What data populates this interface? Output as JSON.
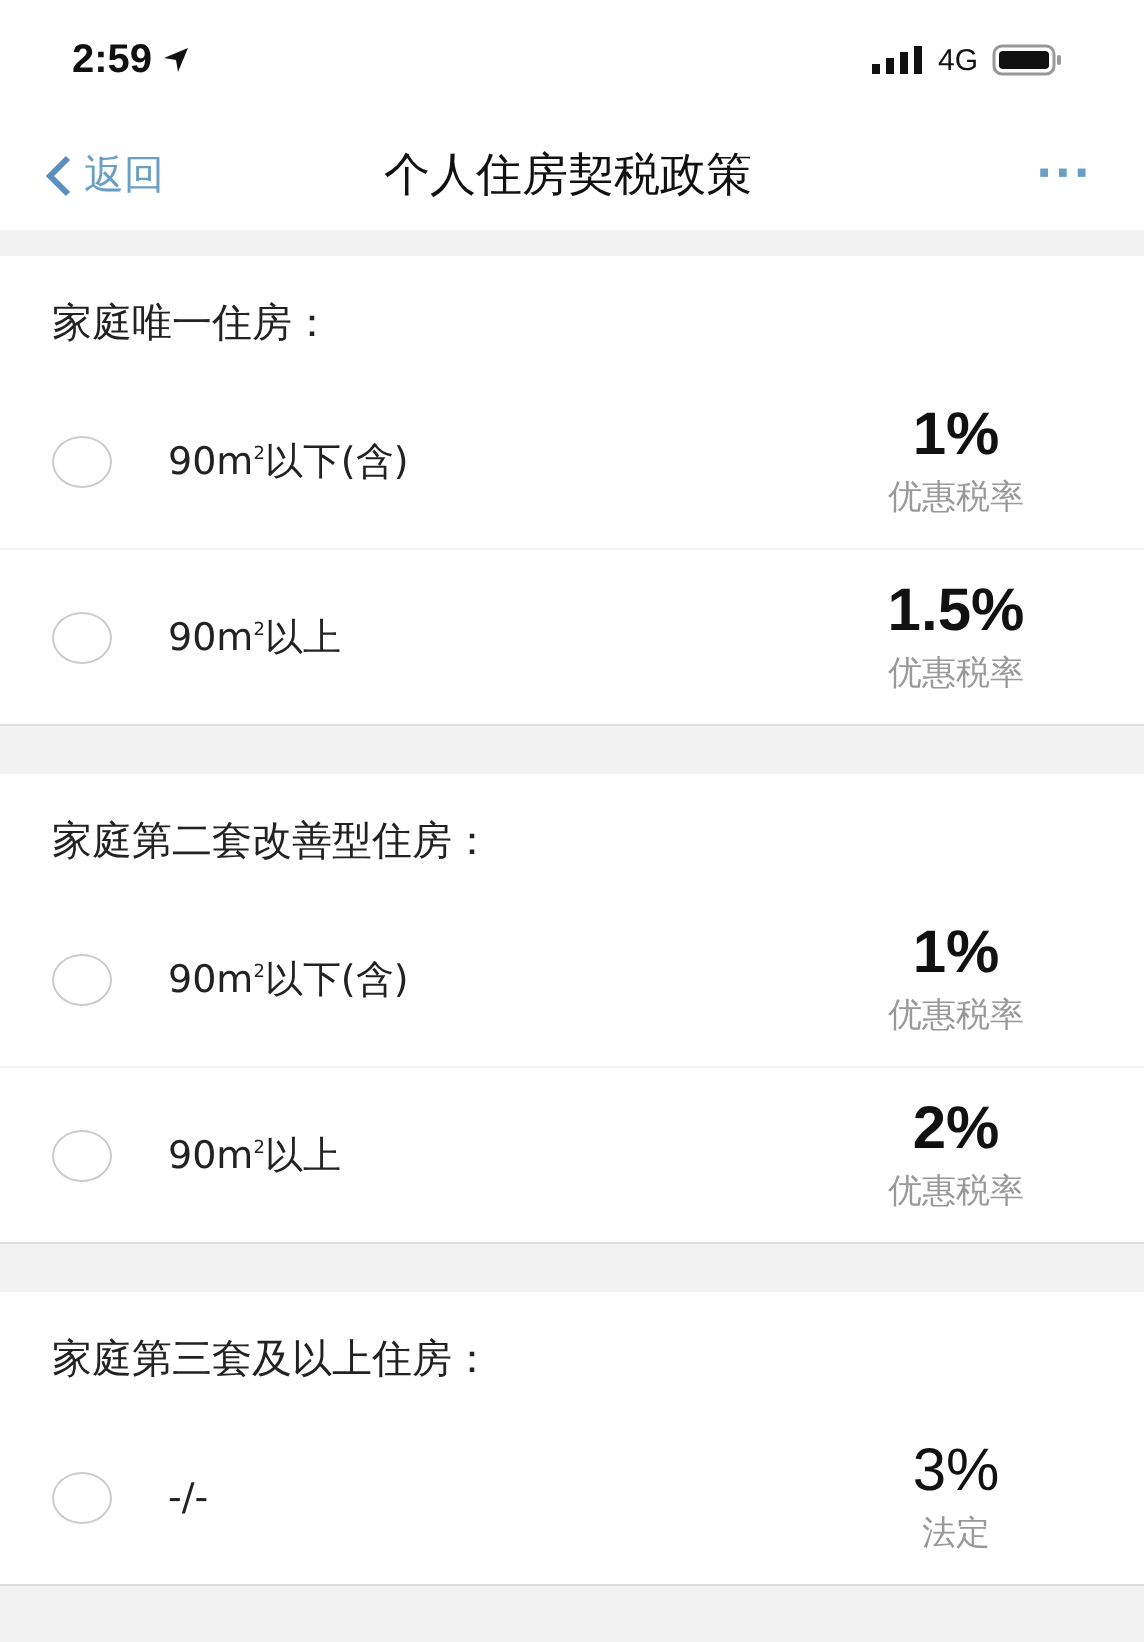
{
  "status_bar": {
    "time": "2:59",
    "network": "4G"
  },
  "nav": {
    "back": "返回",
    "title": "个人住房契税政策",
    "more": "···"
  },
  "sections": [
    {
      "title": "家庭唯一住房：",
      "options": [
        {
          "label": "90m$^{2}$以下(含)",
          "rate": "1%",
          "rate_bold": true,
          "note": "优惠税率",
          "selected": false
        },
        {
          "label": "90m$^{2}$以上",
          "rate": "1.5%",
          "rate_bold": true,
          "note": "优惠税率",
          "selected": false
        }
      ]
    },
    {
      "title": "家庭第二套改善型住房：",
      "options": [
        {
          "label": "90m$^{2}$以下(含)",
          "rate": "1%",
          "rate_bold": true,
          "note": "优惠税率",
          "selected": false
        },
        {
          "label": "90m$^{2}$以上",
          "rate": "2%",
          "rate_bold": true,
          "note": "优惠税率",
          "selected": false
        }
      ]
    },
    {
      "title": "家庭第三套及以上住房：",
      "options": [
        {
          "label": "-/-",
          "rate": "3%",
          "rate_bold": false,
          "note": "法定",
          "selected": false
        }
      ]
    }
  ]
}
